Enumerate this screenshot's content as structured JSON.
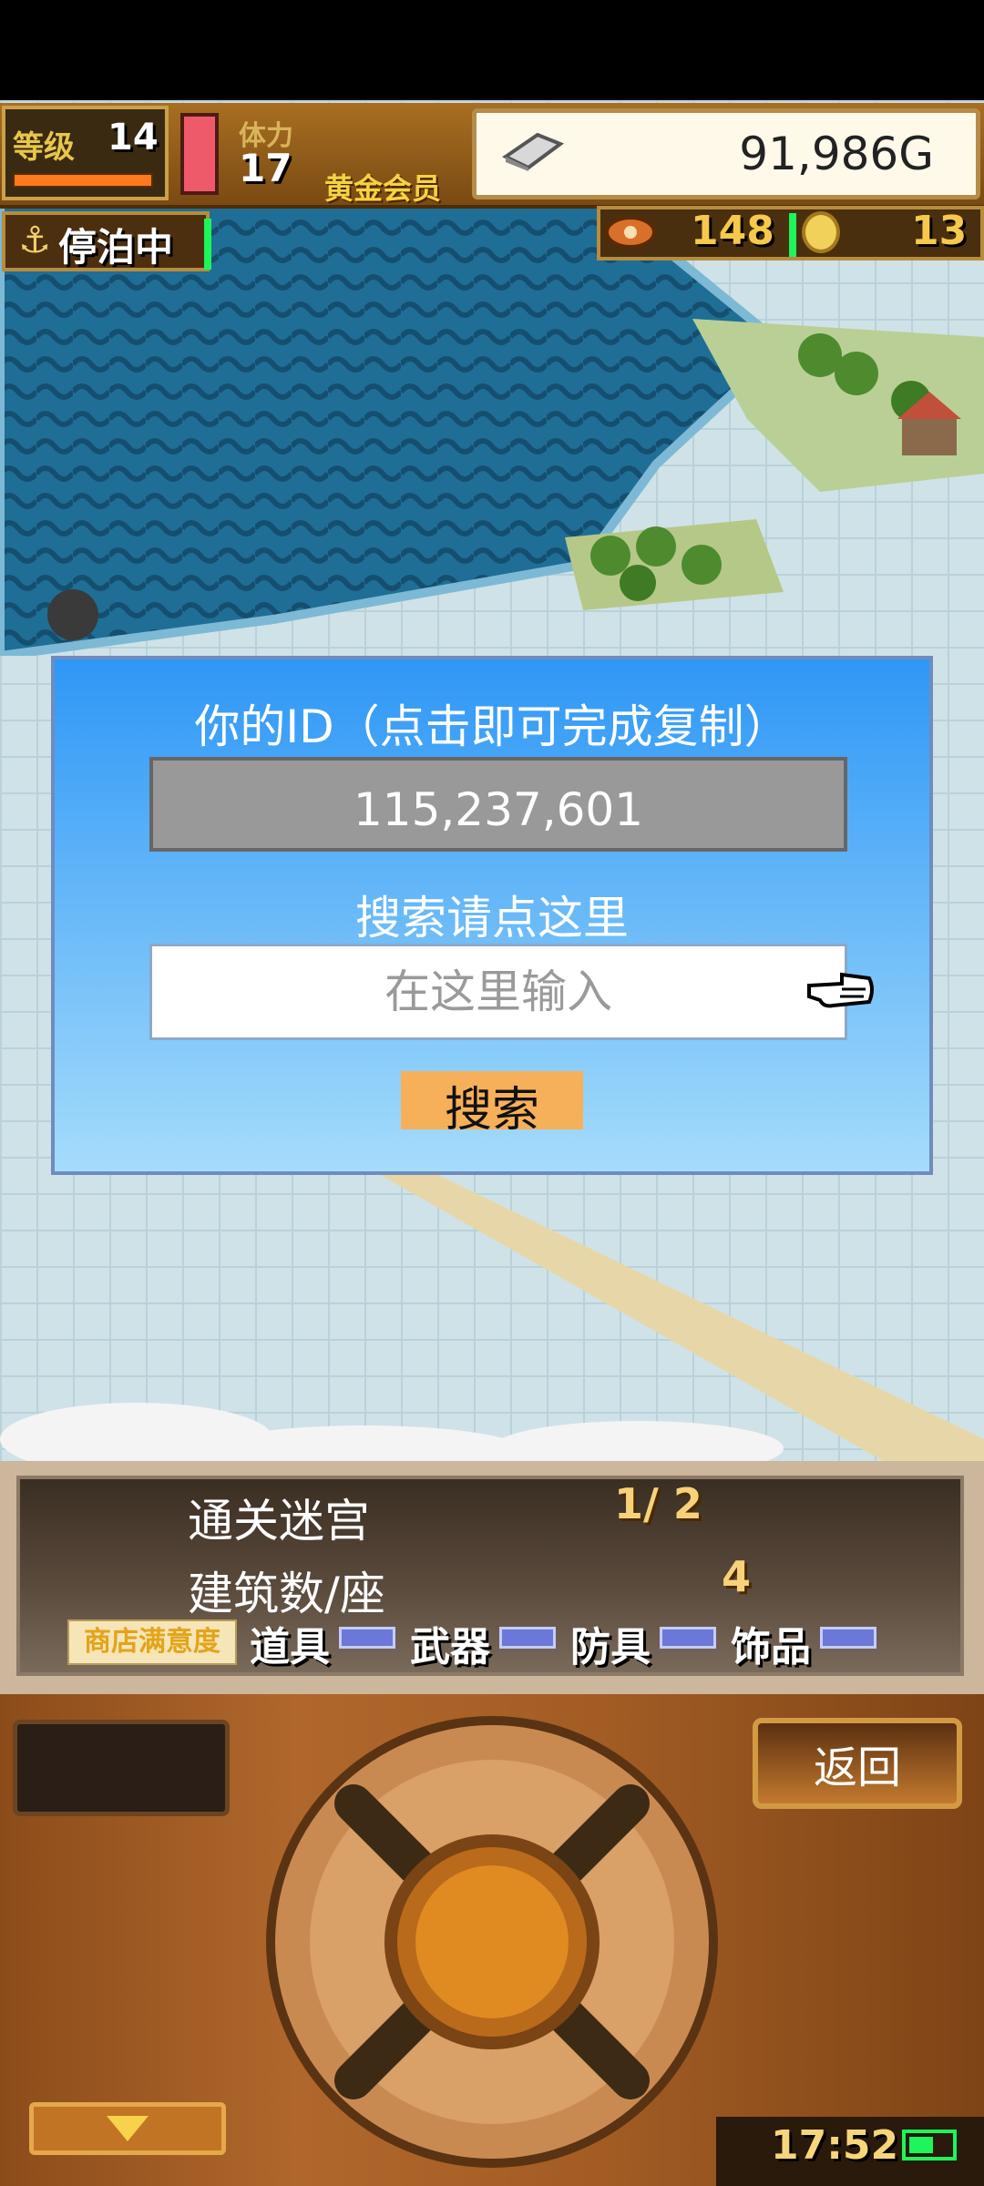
{
  "hud": {
    "level_label": "等级",
    "level": "14",
    "stamina_label": "体力",
    "stamina": "17",
    "vip_label": "黄金会员",
    "gold": "91,986G",
    "status": "停泊中",
    "meat": "148",
    "medals": "13"
  },
  "dialog": {
    "title": "你的ID（点击即可完成复制）",
    "user_id": "115,237,601",
    "search_label": "搜索请点这里",
    "input_placeholder": "在这里输入",
    "search_button": "搜索"
  },
  "status_panel": {
    "dungeon_label": "通关迷宫",
    "dungeon_value": "1/ 2",
    "buildings_label": "建筑数/座",
    "buildings_value": "4",
    "shop_satisfaction_label": "商店满意度",
    "categories": [
      "道具",
      "武器",
      "防具",
      "饰品"
    ]
  },
  "controls": {
    "back_button": "返回",
    "clock": "17:52"
  },
  "colors": {
    "dialog_top": "#2e97f6",
    "dialog_bottom": "#a5dcfb",
    "search_button": "#f7b05a",
    "battery": "#1ef55a"
  }
}
